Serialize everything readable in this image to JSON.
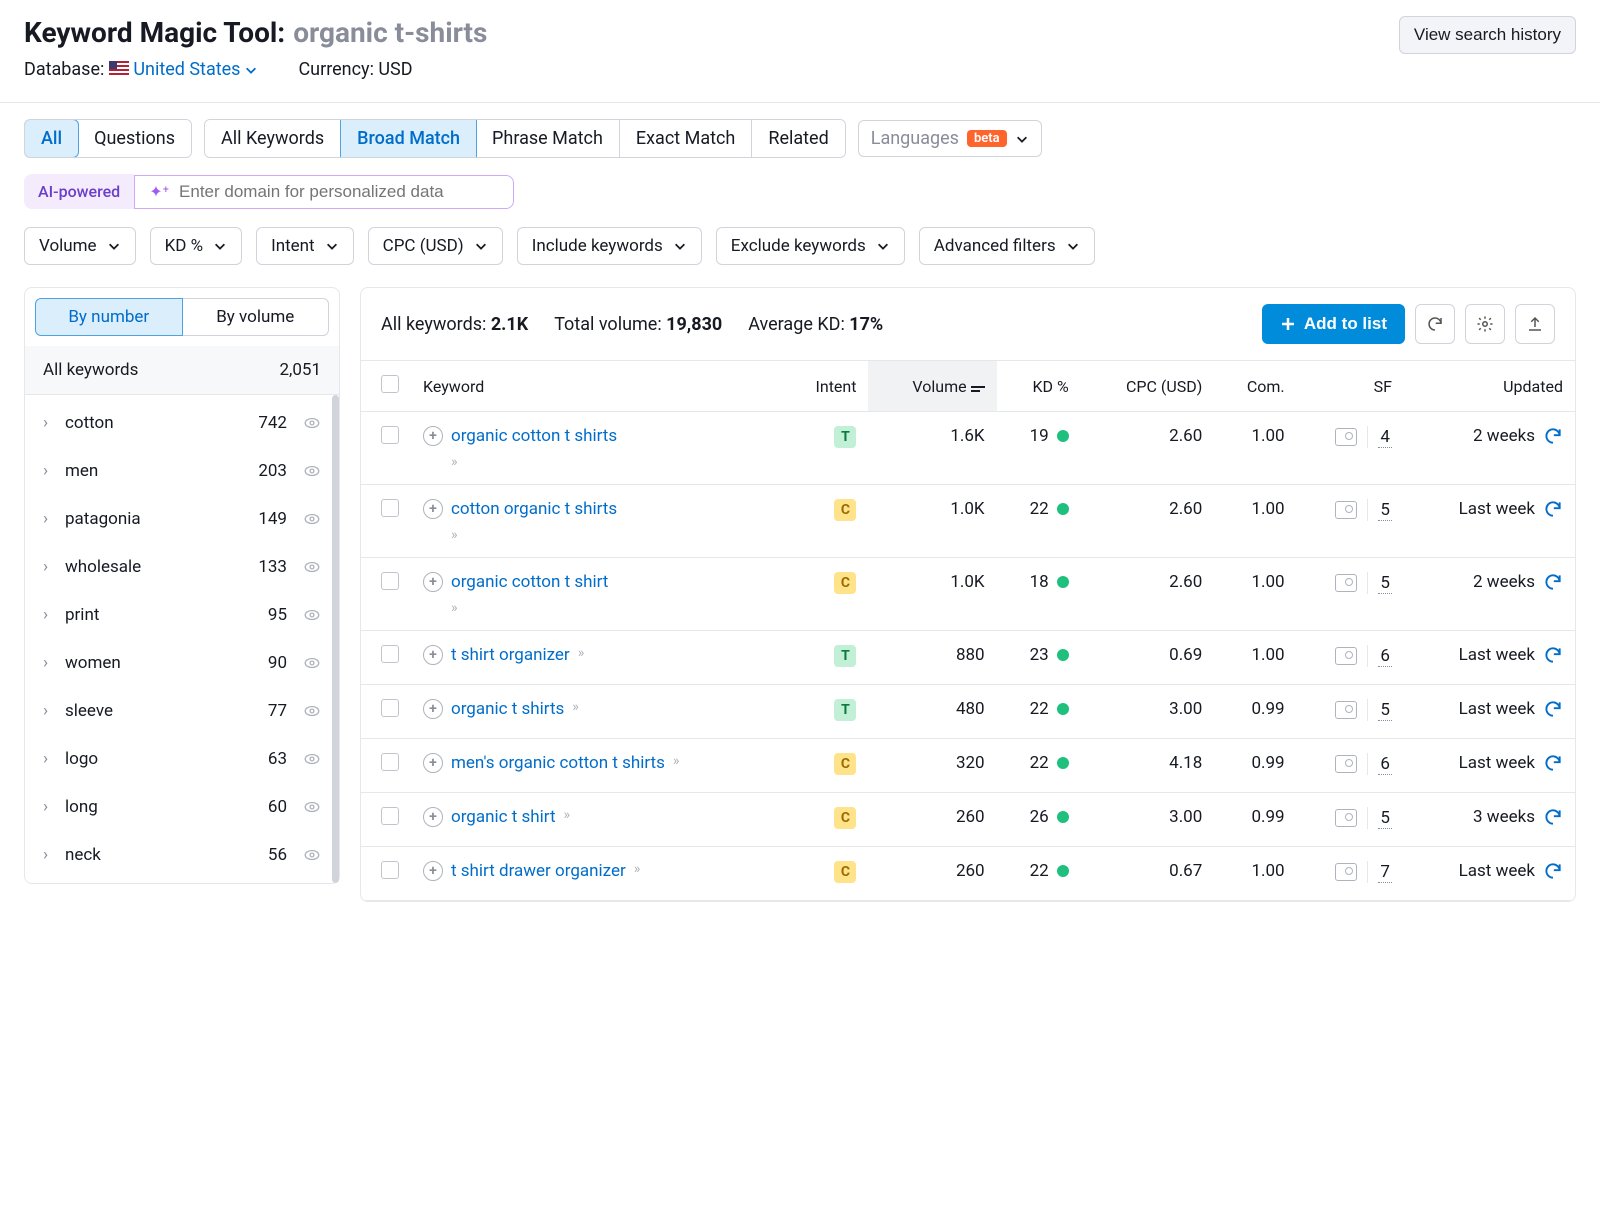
{
  "header": {
    "title_prefix": "Keyword Magic Tool:",
    "query": "organic t-shirts",
    "database_label": "Database:",
    "database_value": "United States",
    "currency_label": "Currency: USD",
    "history_btn": "View search history"
  },
  "tabs": {
    "group1": [
      "All",
      "Questions"
    ],
    "group1_active": "All",
    "group2": [
      "All Keywords",
      "Broad Match",
      "Phrase Match",
      "Exact Match",
      "Related"
    ],
    "group2_active": "Broad Match",
    "languages_label": "Languages",
    "beta": "beta"
  },
  "ai": {
    "label": "AI-powered",
    "placeholder": "Enter domain for personalized data"
  },
  "filters": [
    "Volume",
    "KD %",
    "Intent",
    "CPC (USD)",
    "Include keywords",
    "Exclude keywords",
    "Advanced filters"
  ],
  "sidebar": {
    "tabs": [
      "By number",
      "By volume"
    ],
    "active_tab": "By number",
    "all_label": "All keywords",
    "all_count": "2,051",
    "items": [
      {
        "name": "cotton",
        "count": "742"
      },
      {
        "name": "men",
        "count": "203"
      },
      {
        "name": "patagonia",
        "count": "149"
      },
      {
        "name": "wholesale",
        "count": "133"
      },
      {
        "name": "print",
        "count": "95"
      },
      {
        "name": "women",
        "count": "90"
      },
      {
        "name": "sleeve",
        "count": "77"
      },
      {
        "name": "logo",
        "count": "63"
      },
      {
        "name": "long",
        "count": "60"
      },
      {
        "name": "neck",
        "count": "56"
      }
    ]
  },
  "summary": {
    "all_label": "All keywords:",
    "all_value": "2.1K",
    "vol_label": "Total volume:",
    "vol_value": "19,830",
    "kd_label": "Average KD:",
    "kd_value": "17%",
    "add_btn": "Add to list"
  },
  "columns": {
    "keyword": "Keyword",
    "intent": "Intent",
    "volume": "Volume",
    "kd": "KD %",
    "cpc": "CPC (USD)",
    "com": "Com.",
    "sf": "SF",
    "updated": "Updated"
  },
  "rows": [
    {
      "keyword": "organic cotton t shirts",
      "intent": "T",
      "volume": "1.6K",
      "kd": "19",
      "cpc": "2.60",
      "com": "1.00",
      "sf": "4",
      "updated": "2 weeks",
      "wrap": true
    },
    {
      "keyword": "cotton organic t shirts",
      "intent": "C",
      "volume": "1.0K",
      "kd": "22",
      "cpc": "2.60",
      "com": "1.00",
      "sf": "5",
      "updated": "Last week",
      "wrap": true
    },
    {
      "keyword": "organic cotton t shirt",
      "intent": "C",
      "volume": "1.0K",
      "kd": "18",
      "cpc": "2.60",
      "com": "1.00",
      "sf": "5",
      "updated": "2 weeks",
      "wrap": true
    },
    {
      "keyword": "t shirt organizer",
      "intent": "T",
      "volume": "880",
      "kd": "23",
      "cpc": "0.69",
      "com": "1.00",
      "sf": "6",
      "updated": "Last week",
      "wrap": false
    },
    {
      "keyword": "organic t shirts",
      "intent": "T",
      "volume": "480",
      "kd": "22",
      "cpc": "3.00",
      "com": "0.99",
      "sf": "5",
      "updated": "Last week",
      "wrap": false
    },
    {
      "keyword": "men's organic cotton t shirts",
      "intent": "C",
      "volume": "320",
      "kd": "22",
      "cpc": "4.18",
      "com": "0.99",
      "sf": "6",
      "updated": "Last week",
      "wrap": false
    },
    {
      "keyword": "organic t shirt",
      "intent": "C",
      "volume": "260",
      "kd": "26",
      "cpc": "3.00",
      "com": "0.99",
      "sf": "5",
      "updated": "3 weeks",
      "wrap": false
    },
    {
      "keyword": "t shirt drawer organizer",
      "intent": "C",
      "volume": "260",
      "kd": "22",
      "cpc": "0.67",
      "com": "1.00",
      "sf": "7",
      "updated": "Last week",
      "wrap": false
    }
  ]
}
